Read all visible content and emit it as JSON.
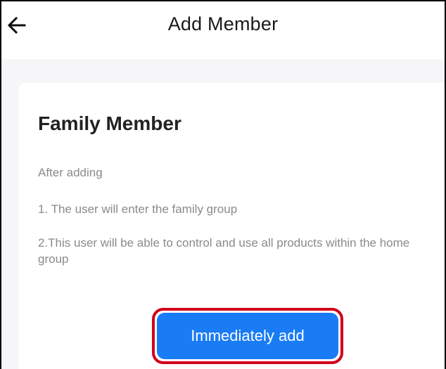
{
  "header": {
    "title": "Add Member",
    "back_icon": "arrow-left-icon"
  },
  "card": {
    "title": "Family Member",
    "intro": "After adding",
    "point_1": "1. The user will enter the family group",
    "point_2": "2.This user will be able to control and use all products within the home group",
    "button_label": "Immediately add"
  },
  "colors": {
    "accent": "#1a7cf5",
    "highlight_border": "#d0021b",
    "background": "#f6f6f8",
    "secondary_text": "#8a8a8a"
  }
}
